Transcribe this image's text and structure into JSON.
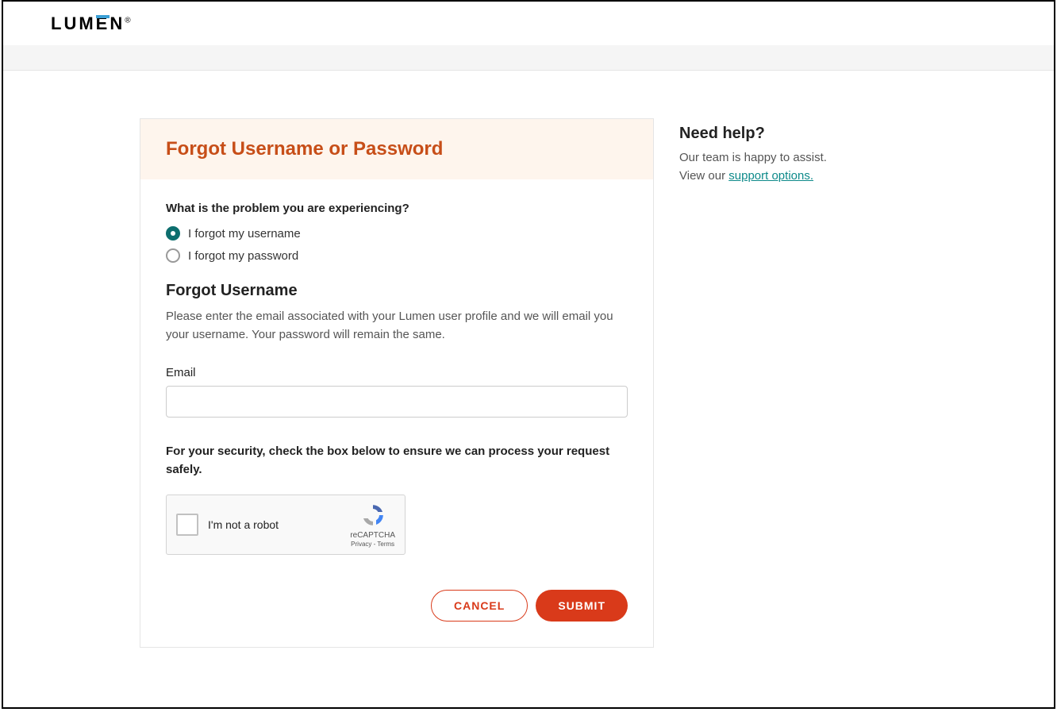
{
  "header": {
    "logo_text": "LUMEN"
  },
  "card": {
    "title": "Forgot Username or Password",
    "question": "What is the problem you are experiencing?",
    "options": [
      {
        "label": "I forgot my username",
        "selected": true
      },
      {
        "label": "I forgot my password",
        "selected": false
      }
    ],
    "section_heading": "Forgot Username",
    "section_desc": "Please enter the email associated with your Lumen user profile and we will email you your username. Your password will remain the same.",
    "email_label": "Email",
    "email_value": "",
    "security_text": "For your security, check the box below to ensure we can process your request safely.",
    "recaptcha_label": "I'm not a robot",
    "recaptcha_brand": "reCAPTCHA",
    "recaptcha_links": "Privacy - Terms",
    "cancel_label": "CANCEL",
    "submit_label": "SUBMIT"
  },
  "sidebar": {
    "title": "Need help?",
    "text_1": "Our team is happy to assist.",
    "text_2_prefix": "View our ",
    "link_text": "support options."
  }
}
